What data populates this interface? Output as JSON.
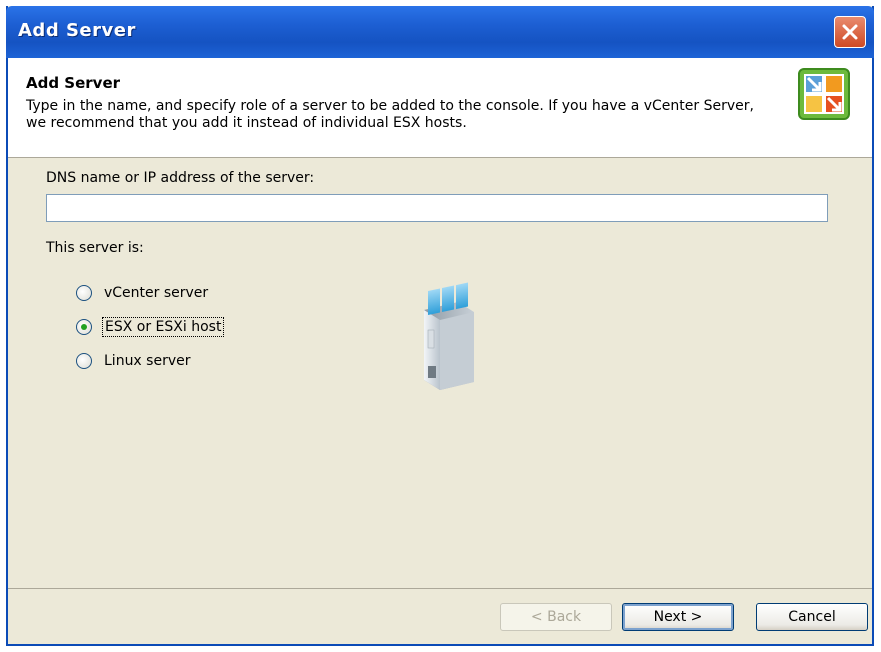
{
  "window": {
    "title": "Add Server",
    "close_icon": "close-icon"
  },
  "header": {
    "title": "Add Server",
    "description": "Type in the name, and specify role of a server to be added to the console. If you have a vCenter Server, we recommend that you add it instead of individual ESX hosts.",
    "logo_icon": "vmware-converter-logo-icon"
  },
  "form": {
    "dns_label": "DNS name or IP address of the server:",
    "dns_value": "",
    "role_label": "This server is:",
    "roles": [
      {
        "label": "vCenter server",
        "checked": false
      },
      {
        "label": "ESX or ESXi host",
        "checked": true
      },
      {
        "label": "Linux server",
        "checked": false
      }
    ],
    "server_icon": "server-tower-icon"
  },
  "buttons": {
    "back": "< Back",
    "next": "Next >",
    "cancel": "Cancel"
  },
  "colors": {
    "titlebar": "#1d5fd3",
    "dialog_bg": "#ece9d8",
    "radio_check": "#21a121"
  }
}
